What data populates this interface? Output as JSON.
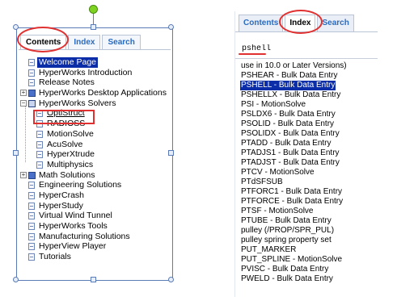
{
  "left": {
    "tabs": [
      "Contents",
      "Index",
      "Search"
    ],
    "active_tab": "Contents",
    "tree": [
      {
        "label": "Welcome Page",
        "icon": "doc",
        "indent": 1,
        "selected": true
      },
      {
        "label": "HyperWorks Introduction",
        "icon": "doc",
        "indent": 1
      },
      {
        "label": "Release Notes",
        "icon": "doc",
        "indent": 1
      },
      {
        "label": "HyperWorks Desktop Applications",
        "icon": "book",
        "indent": 0,
        "toggle": "+"
      },
      {
        "label": "HyperWorks Solvers",
        "icon": "book-open",
        "indent": 0,
        "toggle": "-"
      },
      {
        "label": "OptiStruct",
        "icon": "doc",
        "indent": 2,
        "link": true
      },
      {
        "label": "RADIOSS",
        "icon": "doc",
        "indent": 2
      },
      {
        "label": "MotionSolve",
        "icon": "doc",
        "indent": 2
      },
      {
        "label": "AcuSolve",
        "icon": "doc",
        "indent": 2
      },
      {
        "label": "HyperXtrude",
        "icon": "doc",
        "indent": 2
      },
      {
        "label": "Multiphysics",
        "icon": "doc",
        "indent": 2
      },
      {
        "label": "Math Solutions",
        "icon": "book",
        "indent": 0,
        "toggle": "+"
      },
      {
        "label": "Engineering Solutions",
        "icon": "doc",
        "indent": 1
      },
      {
        "label": "HyperCrash",
        "icon": "doc",
        "indent": 1
      },
      {
        "label": "HyperStudy",
        "icon": "doc",
        "indent": 1
      },
      {
        "label": "Virtual Wind Tunnel",
        "icon": "doc",
        "indent": 1
      },
      {
        "label": "HyperWorks Tools",
        "icon": "doc",
        "indent": 1
      },
      {
        "label": "Manufacturing Solutions",
        "icon": "doc",
        "indent": 1
      },
      {
        "label": "HyperView Player",
        "icon": "doc",
        "indent": 1
      },
      {
        "label": "Tutorials",
        "icon": "doc",
        "indent": 1
      }
    ]
  },
  "right": {
    "tabs": [
      "Contents",
      "Index",
      "Search"
    ],
    "active_tab": "Index",
    "search_value": "pshell",
    "items": [
      "use in 10.0 or Later Versions)",
      "PSHEAR - Bulk Data Entry",
      "PSHELL - Bulk Data Entry",
      "PSHELLX - Bulk Data Entry",
      "PSI - MotionSolve",
      "PSLDX6 - Bulk Data Entry",
      "PSOLID - Bulk Data Entry",
      "PSOLIDX - Bulk Data Entry",
      "PTADD - Bulk Data Entry",
      "PTADJS1 - Bulk Data Entry",
      "PTADJST - Bulk Data Entry",
      "PTCV - MotionSolve",
      "PTdSFSUB",
      "PTFORC1 - Bulk Data Entry",
      "PTFORCE - Bulk Data Entry",
      "PTSF - MotionSolve",
      "PTUBE - Bulk Data Entry",
      "pulley (/PROP/SPR_PUL)",
      "pulley spring property set",
      "PUT_MARKER",
      "PUT_SPLINE - MotionSolve",
      "PVISC - Bulk Data Entry",
      "PWELD - Bulk Data Entry"
    ],
    "selected_index": 2
  },
  "colors": {
    "selection": "#0b2ea8",
    "tab_text": "#2a6bbf",
    "annotation": "#e03030",
    "frame": "#5a7bb5"
  }
}
